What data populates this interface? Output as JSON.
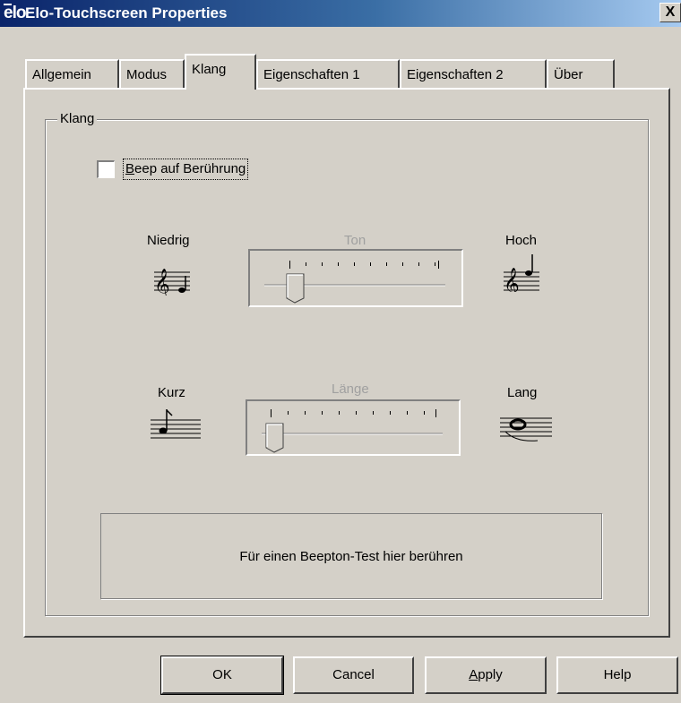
{
  "window": {
    "icon_text": "elo",
    "title": "Elo-Touchscreen Properties",
    "close_label": "X"
  },
  "tabs": [
    {
      "label": "Allgemein"
    },
    {
      "label": "Modus"
    },
    {
      "label": "Klang",
      "active": true
    },
    {
      "label": "Eigenschaften 1"
    },
    {
      "label": "Eigenschaften 2"
    },
    {
      "label": "Über"
    }
  ],
  "klang": {
    "group_label": "Klang",
    "beep_checkbox": {
      "label": "Beep auf Berührung",
      "checked": false
    },
    "tone": {
      "label": "Ton",
      "low_label": "Niedrig",
      "high_label": "Hoch",
      "low_icon": "treble-clef-low-note-icon",
      "high_icon": "treble-clef-high-note-icon",
      "position": 1,
      "tick_count": 11
    },
    "length": {
      "label": "Länge",
      "short_label": "Kurz",
      "long_label": "Lang",
      "short_icon": "short-note-icon",
      "long_icon": "whole-note-icon",
      "position": 0,
      "tick_count": 11
    },
    "test_area_label": "Für einen Beepton-Test hier berühren"
  },
  "buttons": {
    "ok": "OK",
    "cancel": "Cancel",
    "apply": "Apply",
    "help": "Help"
  },
  "colors": {
    "dialog_bg": "#d4d0c8",
    "title_start": "#0a246a",
    "title_end": "#a6caf0",
    "disabled_text": "#a0a0a0"
  }
}
